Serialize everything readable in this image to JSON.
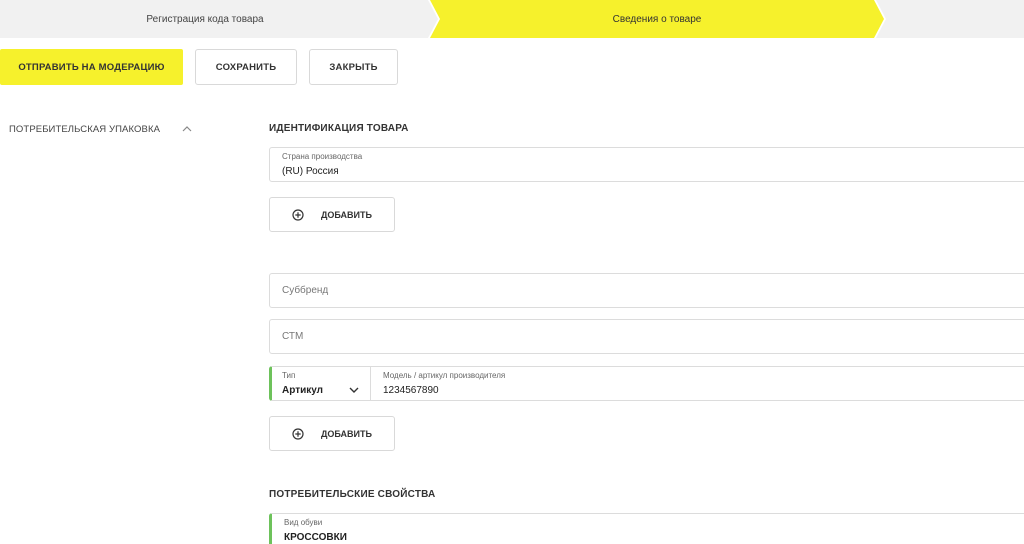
{
  "stepper": {
    "steps": [
      {
        "label": "Регистрация кода товара",
        "state": "done"
      },
      {
        "label": "Сведения о товаре",
        "state": "active"
      },
      {
        "label": "",
        "state": "pending"
      }
    ],
    "colors": {
      "active": "#f6f12c",
      "inactive": "#f1f1f1"
    }
  },
  "toolbar": {
    "submit_label": "ОТПРАВИТЬ НА МОДЕРАЦИЮ",
    "save_label": "СОХРАНИТЬ",
    "close_label": "ЗАКРЫТЬ"
  },
  "sidebar": {
    "items": [
      {
        "label": "ПОТРЕБИТЕЛЬСКАЯ УПАКОВКА",
        "icon": "chevron-up-icon",
        "expanded": true
      }
    ]
  },
  "identification": {
    "title": "ИДЕНТИФИКАЦИЯ ТОВАРА",
    "country": {
      "label": "Страна производства",
      "value": "(RU) Россия"
    },
    "add_label": "ДОБАВИТЬ",
    "subbrand": {
      "placeholder": "Суббренд"
    },
    "ctm": {
      "placeholder": "СТМ"
    },
    "type": {
      "label": "Тип",
      "value": "Артикул"
    },
    "model": {
      "label": "Модель / артикул производителя",
      "value": "1234567890"
    },
    "add_label_2": "ДОБАВИТЬ"
  },
  "consumer": {
    "title": "ПОТРЕБИТЕЛЬСКИЕ СВОЙСТВА",
    "shoe_type": {
      "label": "Вид обуви",
      "value": "КРОССОВКИ"
    }
  },
  "colors": {
    "accent": "#f6f12c",
    "required_marker": "#6dc25b"
  }
}
